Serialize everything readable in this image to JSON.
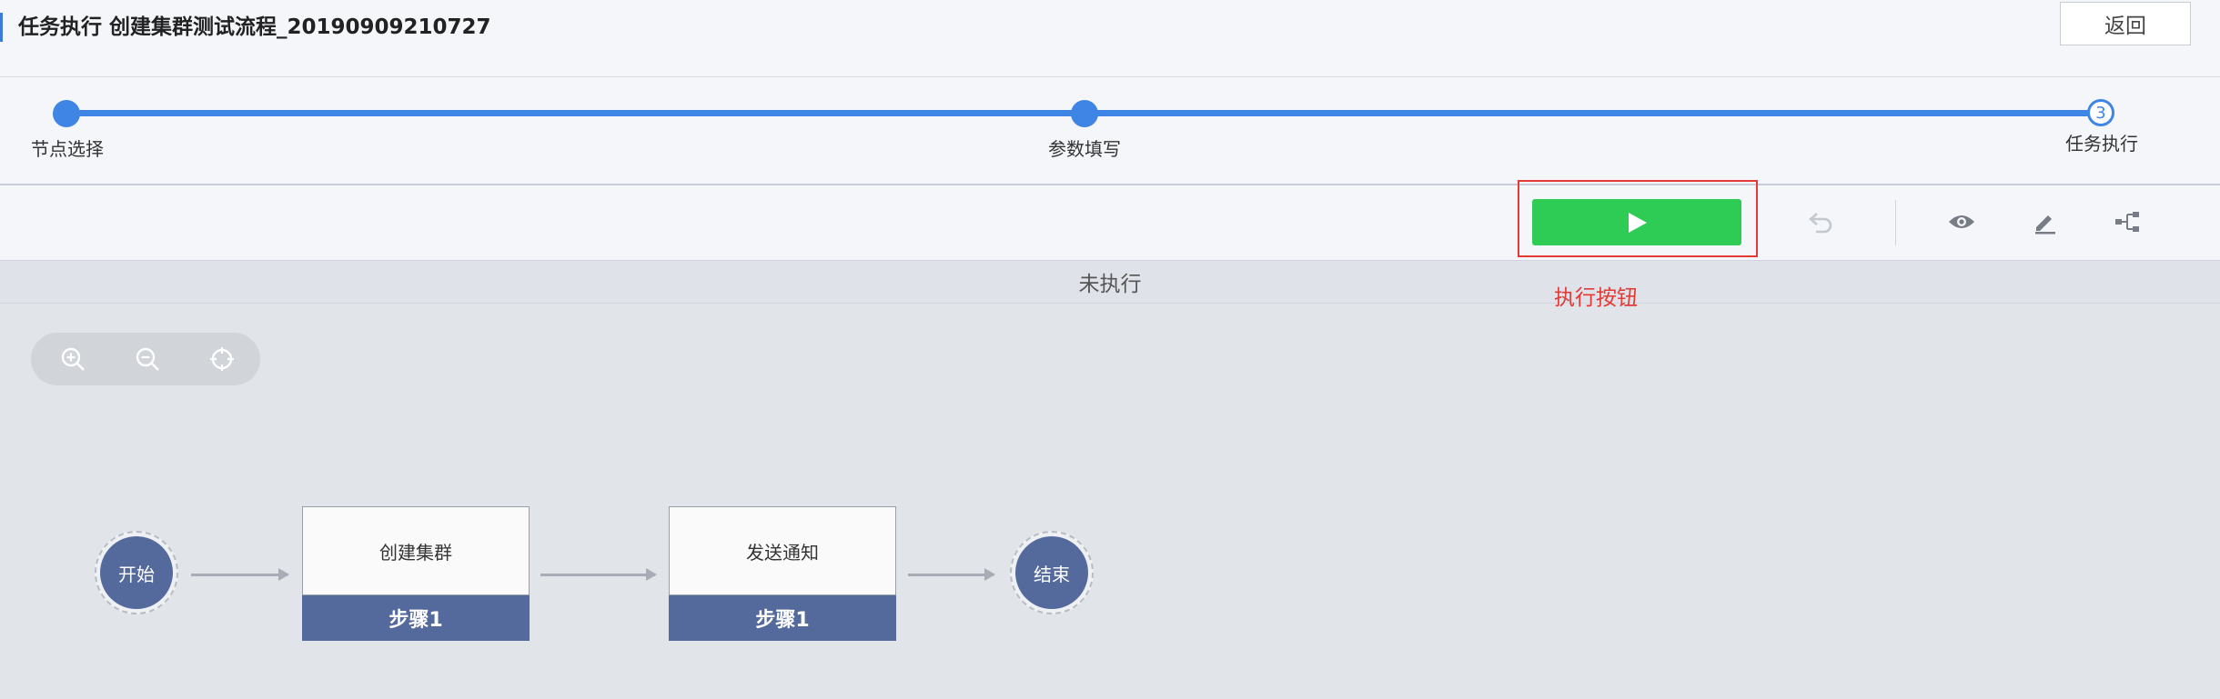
{
  "header": {
    "title": "任务执行 创建集群测试流程_20190909210727",
    "back_label": "返回"
  },
  "stepper": {
    "steps": [
      {
        "label": "节点选择"
      },
      {
        "label": "参数填写"
      },
      {
        "label": "任务执行",
        "number": "3"
      }
    ]
  },
  "toolbar": {
    "run_icon": "play-icon",
    "tools": [
      "undo-icon",
      "eye-icon",
      "pencil-icon",
      "tree-icon"
    ]
  },
  "status": {
    "text": "未执行"
  },
  "annotation": {
    "text": "执行按钮"
  },
  "canvas": {
    "zoom_tools": [
      "zoom-in-icon",
      "zoom-out-icon",
      "crosshair-icon"
    ],
    "start_label": "开始",
    "end_label": "结束",
    "steps": [
      {
        "name": "创建集群",
        "tag": "步骤1"
      },
      {
        "name": "发送通知",
        "tag": "步骤1"
      }
    ]
  },
  "colors": {
    "accent": "#3f85e6",
    "run": "#2ecc55",
    "node": "#556a9c",
    "highlight": "#e53935"
  }
}
